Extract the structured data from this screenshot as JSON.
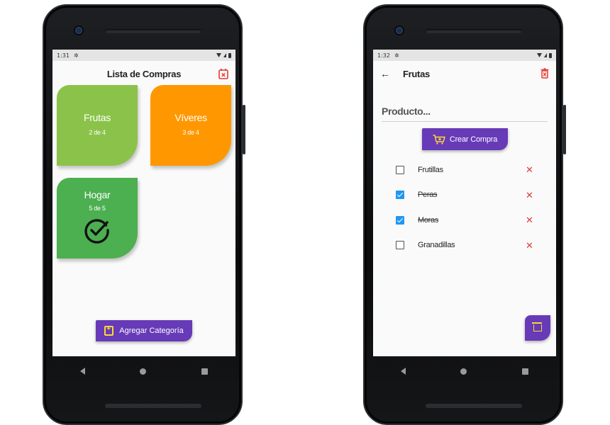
{
  "left_screen": {
    "status": {
      "time": "1:31"
    },
    "title": "Lista de Compras",
    "header_action_icon": "calendar-remove-icon",
    "categories": [
      {
        "name": "Frutas",
        "progress": "2 de 4",
        "color": "#8bc34a"
      },
      {
        "name": "Víveres",
        "progress": "3 de 4",
        "color": "#ff9800"
      },
      {
        "name": "Hogar",
        "progress": "5 de 5",
        "color": "#4caf50",
        "completed": true
      }
    ],
    "add_button_label": "Agregar Categoría"
  },
  "right_screen": {
    "status": {
      "time": "1:32"
    },
    "title": "Frutas",
    "input_placeholder": "Producto...",
    "buy_button_label": "Crear Compra",
    "items": [
      {
        "label": "Frutillas",
        "checked": false
      },
      {
        "label": "Peras",
        "checked": true
      },
      {
        "label": "Moras",
        "checked": true
      },
      {
        "label": "Granadillas",
        "checked": false
      }
    ]
  },
  "colors": {
    "accent": "#673ab7",
    "icon_accent": "#fdd835",
    "delete": "#e53935",
    "checkbox": "#2196f3"
  }
}
